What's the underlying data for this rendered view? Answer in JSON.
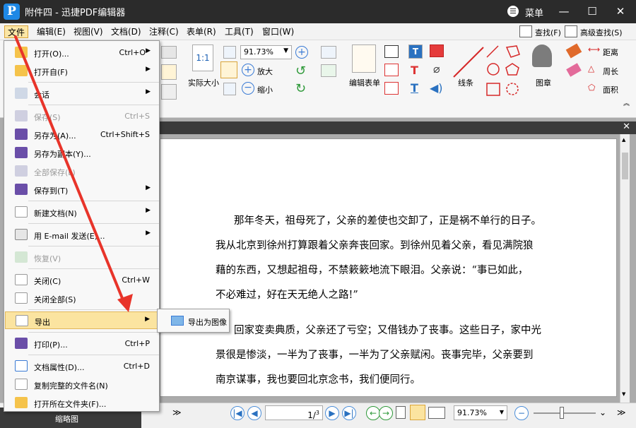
{
  "window": {
    "title": "附件四 - 迅捷PDF编辑器",
    "logo_letter": "P",
    "menu_label": "菜单",
    "minimize": "—",
    "maximize": "☐",
    "close": "✕"
  },
  "menubar": [
    "文件",
    "编辑(E)",
    "视图(V)",
    "文档(D)",
    "注释(C)",
    "表单(R)",
    "工具(T)",
    "窗口(W)"
  ],
  "search": {
    "find": "查找(F)",
    "advanced": "高级查找(S)"
  },
  "ribbon": {
    "zoom_value": "91.73%",
    "actual_size": "实际大小",
    "fit_page_icon_text": "1:1",
    "zoom_in": "放大",
    "zoom_out": "缩小",
    "edit_form": "编辑表单",
    "lines": "线条",
    "stamp": "图章",
    "distance": "距离",
    "perimeter": "周长",
    "area": "面积"
  },
  "file_menu": {
    "open": "打开(O)...",
    "open_shortcut": "Ctrl+O",
    "open_from": "打开自(F)",
    "session": "会话",
    "save": "保存(S)",
    "save_shortcut": "Ctrl+S",
    "save_as": "另存为(A)...",
    "save_as_shortcut": "Ctrl+Shift+S",
    "save_copy": "另存为副本(Y)...",
    "save_all": "全部保存(L)",
    "save_to": "保存到(T)",
    "new_doc": "新建文档(N)",
    "email": "用 E-mail 发送(E)...",
    "revert": "恢复(V)",
    "close": "关闭(C)",
    "close_shortcut": "Ctrl+W",
    "close_all": "关闭全部(S)",
    "export": "导出",
    "print": "打印(P)...",
    "print_shortcut": "Ctrl+P",
    "properties": "文档属性(D)...",
    "properties_shortcut": "Ctrl+D",
    "copy_name": "复制完整的文件名(N)",
    "open_folder": "打开所在文件夹(F)..."
  },
  "submenu": {
    "export_image": "导出为图像"
  },
  "document": {
    "paragraphs": [
      "那年冬天，祖母死了，父亲的差使也交卸了，正是祸不单行的日子。",
      "我从北京到徐州打算跟着父亲奔丧回家。到徐州见着父亲，看见满院狼",
      "藉的东西，又想起祖母，不禁簌簌地流下眼泪。父亲说：“事已如此，",
      "不必难过，好在天无绝人之路!”",
      "回家变卖典质，父亲还了亏空；又借钱办了丧事。这些日子，家中光",
      "景很是惨淡，一半为了丧事，一半为了父亲赋闲。丧事完毕，父亲要到",
      "南京谋事，我也要回北京念书，我们便同行。"
    ]
  },
  "statusbar": {
    "page": "1",
    "page_total": "3",
    "zoom": "91.73%",
    "left_tab": "缩略图"
  },
  "colors": {
    "arrow": "#e8342a",
    "title_bar": "#2b2b2b",
    "accent": "#fbe4a0"
  }
}
